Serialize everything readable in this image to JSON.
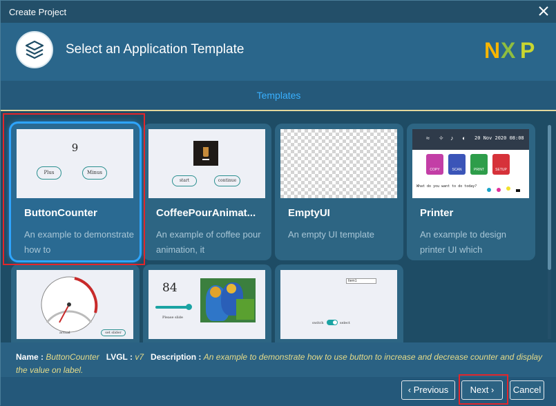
{
  "window": {
    "title": "Create Project"
  },
  "header": {
    "title": "Select an Application Template",
    "brand": "NXP"
  },
  "tabs": {
    "active": "Templates"
  },
  "templates": [
    {
      "name": "ButtonCounter",
      "desc": "An example to demonstrate how to",
      "preview": {
        "counter": "9",
        "btn1": "Plus",
        "btn2": "Minus"
      }
    },
    {
      "name": "CoffeePourAnimat...",
      "desc": "An example of coffee pour animation, it",
      "preview": {
        "btn1": "start",
        "btn2": "continue"
      }
    },
    {
      "name": "EmptyUI",
      "desc": "An empty UI template"
    },
    {
      "name": "Printer",
      "desc": "An example to design printer UI which",
      "preview": {
        "date": "20 Nov 2020 08:08",
        "question": "What do you want to do today?",
        "tiles": [
          "COPY",
          "SCAN",
          "PRINT",
          "SETUP"
        ]
      }
    },
    {
      "name": "",
      "desc": "",
      "preview": {
        "label1": "actual",
        "label2": "set slider"
      }
    },
    {
      "name": "",
      "desc": "",
      "preview": {
        "value": "84",
        "label": "Please slide"
      }
    },
    {
      "name": "",
      "desc": "",
      "preview": {
        "select": "Item1",
        "switch_left": "switch",
        "switch_right": "select"
      }
    }
  ],
  "selected_info": {
    "name_label": "Name :",
    "name_value": "ButtonCounter",
    "lvgl_label": "LVGL :",
    "lvgl_value": "v7",
    "desc_label": "Description :",
    "desc_value": "An example to demonstrate how to use button to increase and decrease counter and display the value on label."
  },
  "buttons": {
    "previous": "Previous",
    "next": "Next",
    "cancel": "Cancel"
  },
  "colors": {
    "accent_blue": "#39b0ff",
    "highlight_red": "#e4252a",
    "info_value": "#e6dc8a"
  }
}
